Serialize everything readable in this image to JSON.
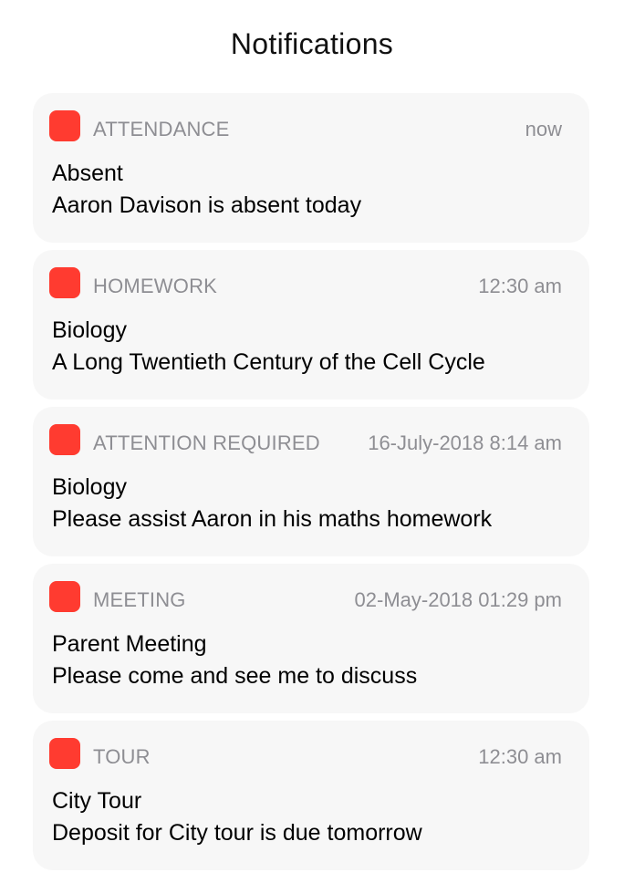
{
  "header": {
    "title": "Notifications"
  },
  "colors": {
    "app_icon": "#ff3b30",
    "card_background": "#f7f7f7",
    "meta_text": "#8e8e93"
  },
  "notifications": [
    {
      "icon": "app-icon",
      "category": "ATTENDANCE",
      "time": "now",
      "title": "Absent",
      "body": "Aaron Davison is absent today"
    },
    {
      "icon": "app-icon",
      "category": "HOMEWORK",
      "time": "12:30 am",
      "title": "Biology",
      "body": "A Long Twentieth Century of the Cell Cycle"
    },
    {
      "icon": "app-icon",
      "category": "ATTENTION REQUIRED",
      "time": "16-July-2018 8:14 am",
      "title": "Biology",
      "body": "Please assist Aaron in his maths homework"
    },
    {
      "icon": "app-icon",
      "category": "MEETING",
      "time": "02-May-2018 01:29 pm",
      "title": "Parent Meeting",
      "body": "Please come and see me to discuss"
    },
    {
      "icon": "app-icon",
      "category": "TOUR",
      "time": "12:30 am",
      "title": "City Tour",
      "body": "Deposit for City tour is due tomorrow"
    }
  ]
}
